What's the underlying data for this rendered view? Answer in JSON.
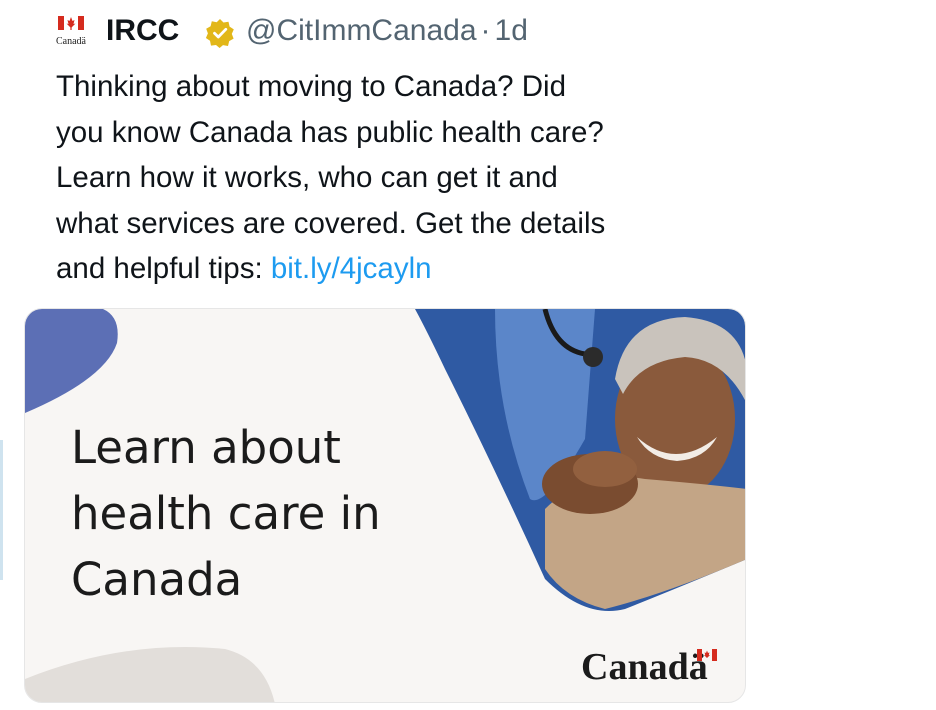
{
  "account": {
    "avatar_label": "Canadä",
    "name": "IRCC",
    "handle": "@CitImmCanada",
    "separator": "·",
    "time": "1d",
    "verified": true
  },
  "tweet": {
    "lines": [
      "Thinking about moving to Canada? Did",
      "you know Canada has public health care?",
      "Learn how it works, who can get it and",
      "what services are covered. Get the details"
    ],
    "last_line_prefix": "and helpful tips: ",
    "link": "bit.ly/4jcayln"
  },
  "card": {
    "headline": [
      "Learn about",
      "health care in",
      "Canada"
    ],
    "wordmark": "Canadä",
    "image_alt": "A nurse rests a hand on the shoulder of a smiling older man"
  },
  "colors": {
    "link": "#1d9bf0",
    "accent_shape": "#5c6fb5",
    "flag_red": "#d52b1e",
    "verified_gold": "#e2b719"
  }
}
